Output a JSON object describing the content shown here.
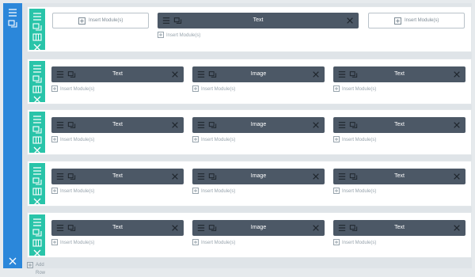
{
  "colors": {
    "section_bar": "#2b87da",
    "row_bar": "#29c4a9",
    "module_bg": "#4c5866",
    "page_bg": "#e6eaed"
  },
  "section": {
    "icons": [
      "hamburger-icon",
      "duplicate-icon",
      "close-icon"
    ]
  },
  "rows": [
    {
      "columns": [
        {
          "type": "insert_button",
          "label": "Insert Module(s)"
        },
        {
          "type": "module",
          "module_label": "Text",
          "insert_label": "Insert Module(s)"
        },
        {
          "type": "insert_button",
          "label": "Insert Module(s)"
        }
      ]
    },
    {
      "columns": [
        {
          "type": "module",
          "module_label": "Text",
          "insert_label": "Insert Module(s)"
        },
        {
          "type": "module",
          "module_label": "Image",
          "insert_label": "Insert Module(s)"
        },
        {
          "type": "module",
          "module_label": "Text",
          "insert_label": "Insert Module(s)"
        }
      ]
    },
    {
      "columns": [
        {
          "type": "module",
          "module_label": "Text",
          "insert_label": "Insert Module(s)"
        },
        {
          "type": "module",
          "module_label": "Image",
          "insert_label": "Insert Module(s)"
        },
        {
          "type": "module",
          "module_label": "Text",
          "insert_label": "Insert Module(s)"
        }
      ]
    },
    {
      "columns": [
        {
          "type": "module",
          "module_label": "Text",
          "insert_label": "Insert Module(s)"
        },
        {
          "type": "module",
          "module_label": "Image",
          "insert_label": "Insert Module(s)"
        },
        {
          "type": "module",
          "module_label": "Text",
          "insert_label": "Insert Module(s)"
        }
      ]
    },
    {
      "columns": [
        {
          "type": "module",
          "module_label": "Text",
          "insert_label": "Insert Module(s)"
        },
        {
          "type": "module",
          "module_label": "Image",
          "insert_label": "Insert Module(s)"
        },
        {
          "type": "module",
          "module_label": "Text",
          "insert_label": "Insert Module(s)"
        }
      ]
    }
  ],
  "add_row_label": "Add Row"
}
